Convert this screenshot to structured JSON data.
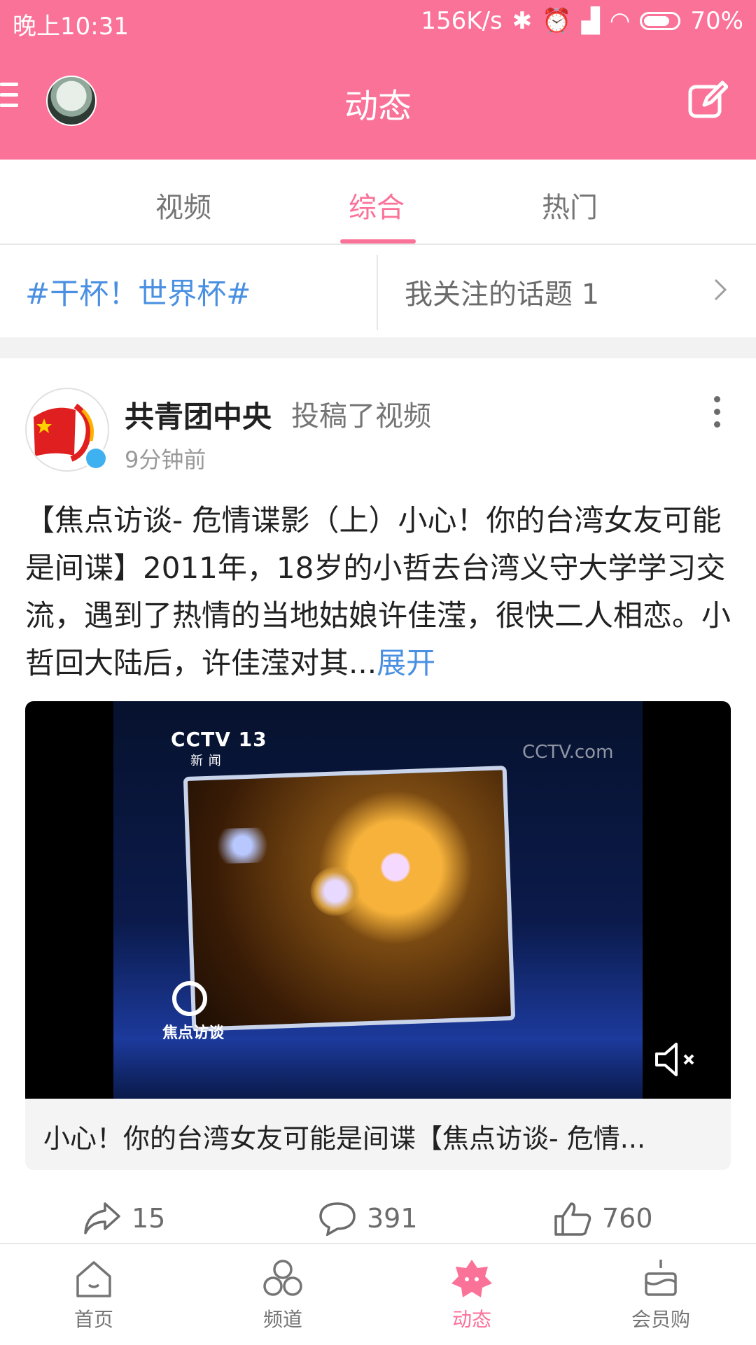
{
  "status_bar": {
    "time": "晚上10:31",
    "speed": "156K/s",
    "battery": "70%"
  },
  "app_bar": {
    "title": "动态"
  },
  "tabs": [
    {
      "label": "视频",
      "active": false
    },
    {
      "label": "综合",
      "active": true
    },
    {
      "label": "热门",
      "active": false
    }
  ],
  "topic": {
    "tag": "#干杯！世界杯#",
    "followed": "我关注的话题 1"
  },
  "post": {
    "author": "共青团中央",
    "action": "投稿了视频",
    "time": "9分钟前",
    "text": "【焦点访谈- 危情谍影（上）小心！你的台湾女友可能是间谍】2011年，18岁的小哲去台湾义守大学学习交流，遇到了热情的当地姑娘许佳滢，很快二人相恋。小哲回大陆后，许佳滢对其...",
    "expand": "展开",
    "video_caption": "小心！你的台湾女友可能是间谍【焦点访谈- 危情...",
    "video_channel": "CCTV 13",
    "video_channel_sub": "新 闻",
    "video_watermark": "CCTV.com",
    "video_program": "焦点访谈",
    "shares": "15",
    "comments": "391",
    "likes": "760"
  },
  "bottom_nav": [
    {
      "label": "首页",
      "icon": "home-icon",
      "active": false
    },
    {
      "label": "频道",
      "icon": "channels-icon",
      "active": false
    },
    {
      "label": "动态",
      "icon": "dynamic-icon",
      "active": true
    },
    {
      "label": "会员购",
      "icon": "cake-icon",
      "active": false
    }
  ],
  "colors": {
    "brand_pink": "#fb7299",
    "link_blue": "#4a90e2"
  }
}
